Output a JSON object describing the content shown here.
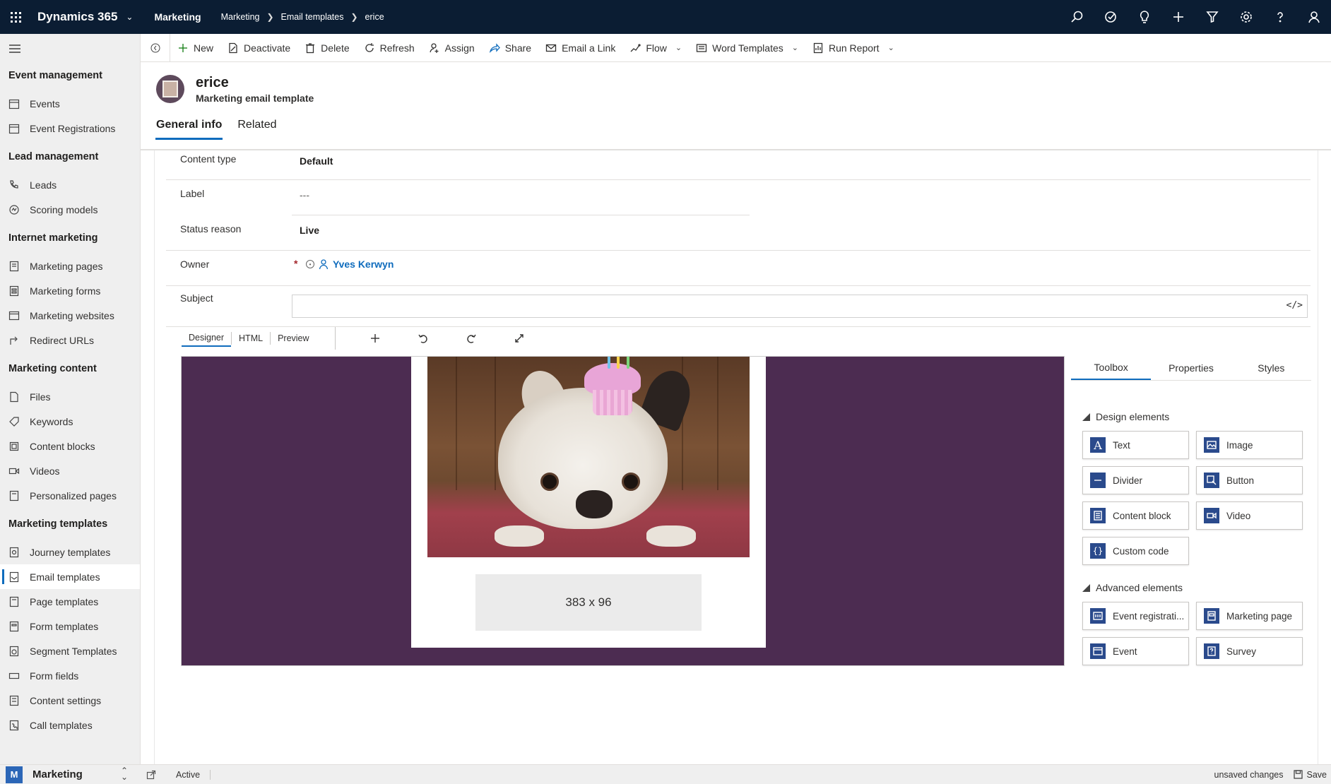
{
  "topbar": {
    "app_name": "Dynamics 365",
    "area": "Marketing",
    "breadcrumb": [
      "Marketing",
      "Email templates",
      "erice"
    ],
    "icons": [
      "search-icon",
      "task-check-icon",
      "lightbulb-icon",
      "plus-icon",
      "filter-icon",
      "gear-icon",
      "help-icon",
      "person-icon"
    ]
  },
  "sidebar": {
    "groups": [
      {
        "title": "Event management",
        "items": [
          {
            "label": "Events",
            "icon": "calendar-icon"
          },
          {
            "label": "Event Registrations",
            "icon": "calendar-icon"
          }
        ]
      },
      {
        "title": "Lead management",
        "items": [
          {
            "label": "Leads",
            "icon": "phone-icon"
          },
          {
            "label": "Scoring models",
            "icon": "score-icon"
          }
        ]
      },
      {
        "title": "Internet marketing",
        "items": [
          {
            "label": "Marketing pages",
            "icon": "page-icon"
          },
          {
            "label": "Marketing forms",
            "icon": "form-icon"
          },
          {
            "label": "Marketing websites",
            "icon": "website-icon"
          },
          {
            "label": "Redirect URLs",
            "icon": "redirect-icon"
          }
        ]
      },
      {
        "title": "Marketing content",
        "items": [
          {
            "label": "Files",
            "icon": "file-icon"
          },
          {
            "label": "Keywords",
            "icon": "tag-icon"
          },
          {
            "label": "Content blocks",
            "icon": "block-icon"
          },
          {
            "label": "Videos",
            "icon": "video-icon"
          },
          {
            "label": "Personalized pages",
            "icon": "page-icon"
          }
        ]
      },
      {
        "title": "Marketing templates",
        "items": [
          {
            "label": "Journey templates",
            "icon": "journey-icon"
          },
          {
            "label": "Email templates",
            "icon": "email-template-icon",
            "active": true
          },
          {
            "label": "Page templates",
            "icon": "page-icon"
          },
          {
            "label": "Form templates",
            "icon": "form-icon"
          },
          {
            "label": "Segment Templates",
            "icon": "segment-icon"
          },
          {
            "label": "Form fields",
            "icon": "field-icon"
          },
          {
            "label": "Content settings",
            "icon": "settings-icon"
          },
          {
            "label": "Call templates",
            "icon": "call-icon"
          }
        ]
      }
    ],
    "area_badge": "M",
    "area_label": "Marketing"
  },
  "commandbar": {
    "items": [
      {
        "label": "New",
        "icon": "plus-icon"
      },
      {
        "label": "Deactivate",
        "icon": "deactivate-icon"
      },
      {
        "label": "Delete",
        "icon": "trash-icon"
      },
      {
        "label": "Refresh",
        "icon": "refresh-icon"
      },
      {
        "label": "Assign",
        "icon": "assign-icon"
      },
      {
        "label": "Share",
        "icon": "share-icon"
      },
      {
        "label": "Email a Link",
        "icon": "email-link-icon"
      },
      {
        "label": "Flow",
        "icon": "flow-icon",
        "dropdown": true
      },
      {
        "label": "Word Templates",
        "icon": "word-icon",
        "dropdown": true
      },
      {
        "label": "Run Report",
        "icon": "report-icon",
        "dropdown": true
      }
    ]
  },
  "record": {
    "title": "erice",
    "subtitle": "Marketing email template",
    "tabs": [
      "General info",
      "Related"
    ]
  },
  "form": {
    "content_type_label": "Content type",
    "content_type_value": "Default",
    "label_label": "Label",
    "label_value": "---",
    "status_label": "Status reason",
    "status_value": "Live",
    "owner_label": "Owner",
    "owner_required": "*",
    "owner_value": "Yves Kerwyn",
    "subject_label": "Subject",
    "subject_value": "",
    "subject_code_glyph": "</>"
  },
  "designer": {
    "tabs": [
      "Designer",
      "HTML",
      "Preview"
    ],
    "tools": [
      "plus-icon",
      "undo-icon",
      "redo-icon",
      "expand-icon"
    ],
    "placeholder_text": "383 x 96",
    "canvas_color": "#4c2c51"
  },
  "toolbox": {
    "tabs": [
      "Toolbox",
      "Properties",
      "Styles"
    ],
    "design_title": "Design elements",
    "design_elements": [
      {
        "label": "Text",
        "glyph": "A"
      },
      {
        "label": "Image",
        "icon": "image-icon"
      },
      {
        "label": "Divider",
        "icon": "divider-icon"
      },
      {
        "label": "Button",
        "icon": "button-icon"
      },
      {
        "label": "Content block",
        "icon": "content-block-icon"
      },
      {
        "label": "Video",
        "icon": "video-icon"
      },
      {
        "label": "Custom code",
        "glyph": "{}"
      }
    ],
    "advanced_title": "Advanced elements",
    "advanced_elements": [
      {
        "label": "Event registrati...",
        "icon": "event-registration-icon"
      },
      {
        "label": "Marketing page",
        "icon": "marketing-page-icon"
      },
      {
        "label": "Event",
        "icon": "event-icon"
      },
      {
        "label": "Survey",
        "icon": "survey-icon"
      }
    ]
  },
  "statusbar": {
    "status": "Active",
    "unsaved": "unsaved changes",
    "save_label": "Save"
  }
}
